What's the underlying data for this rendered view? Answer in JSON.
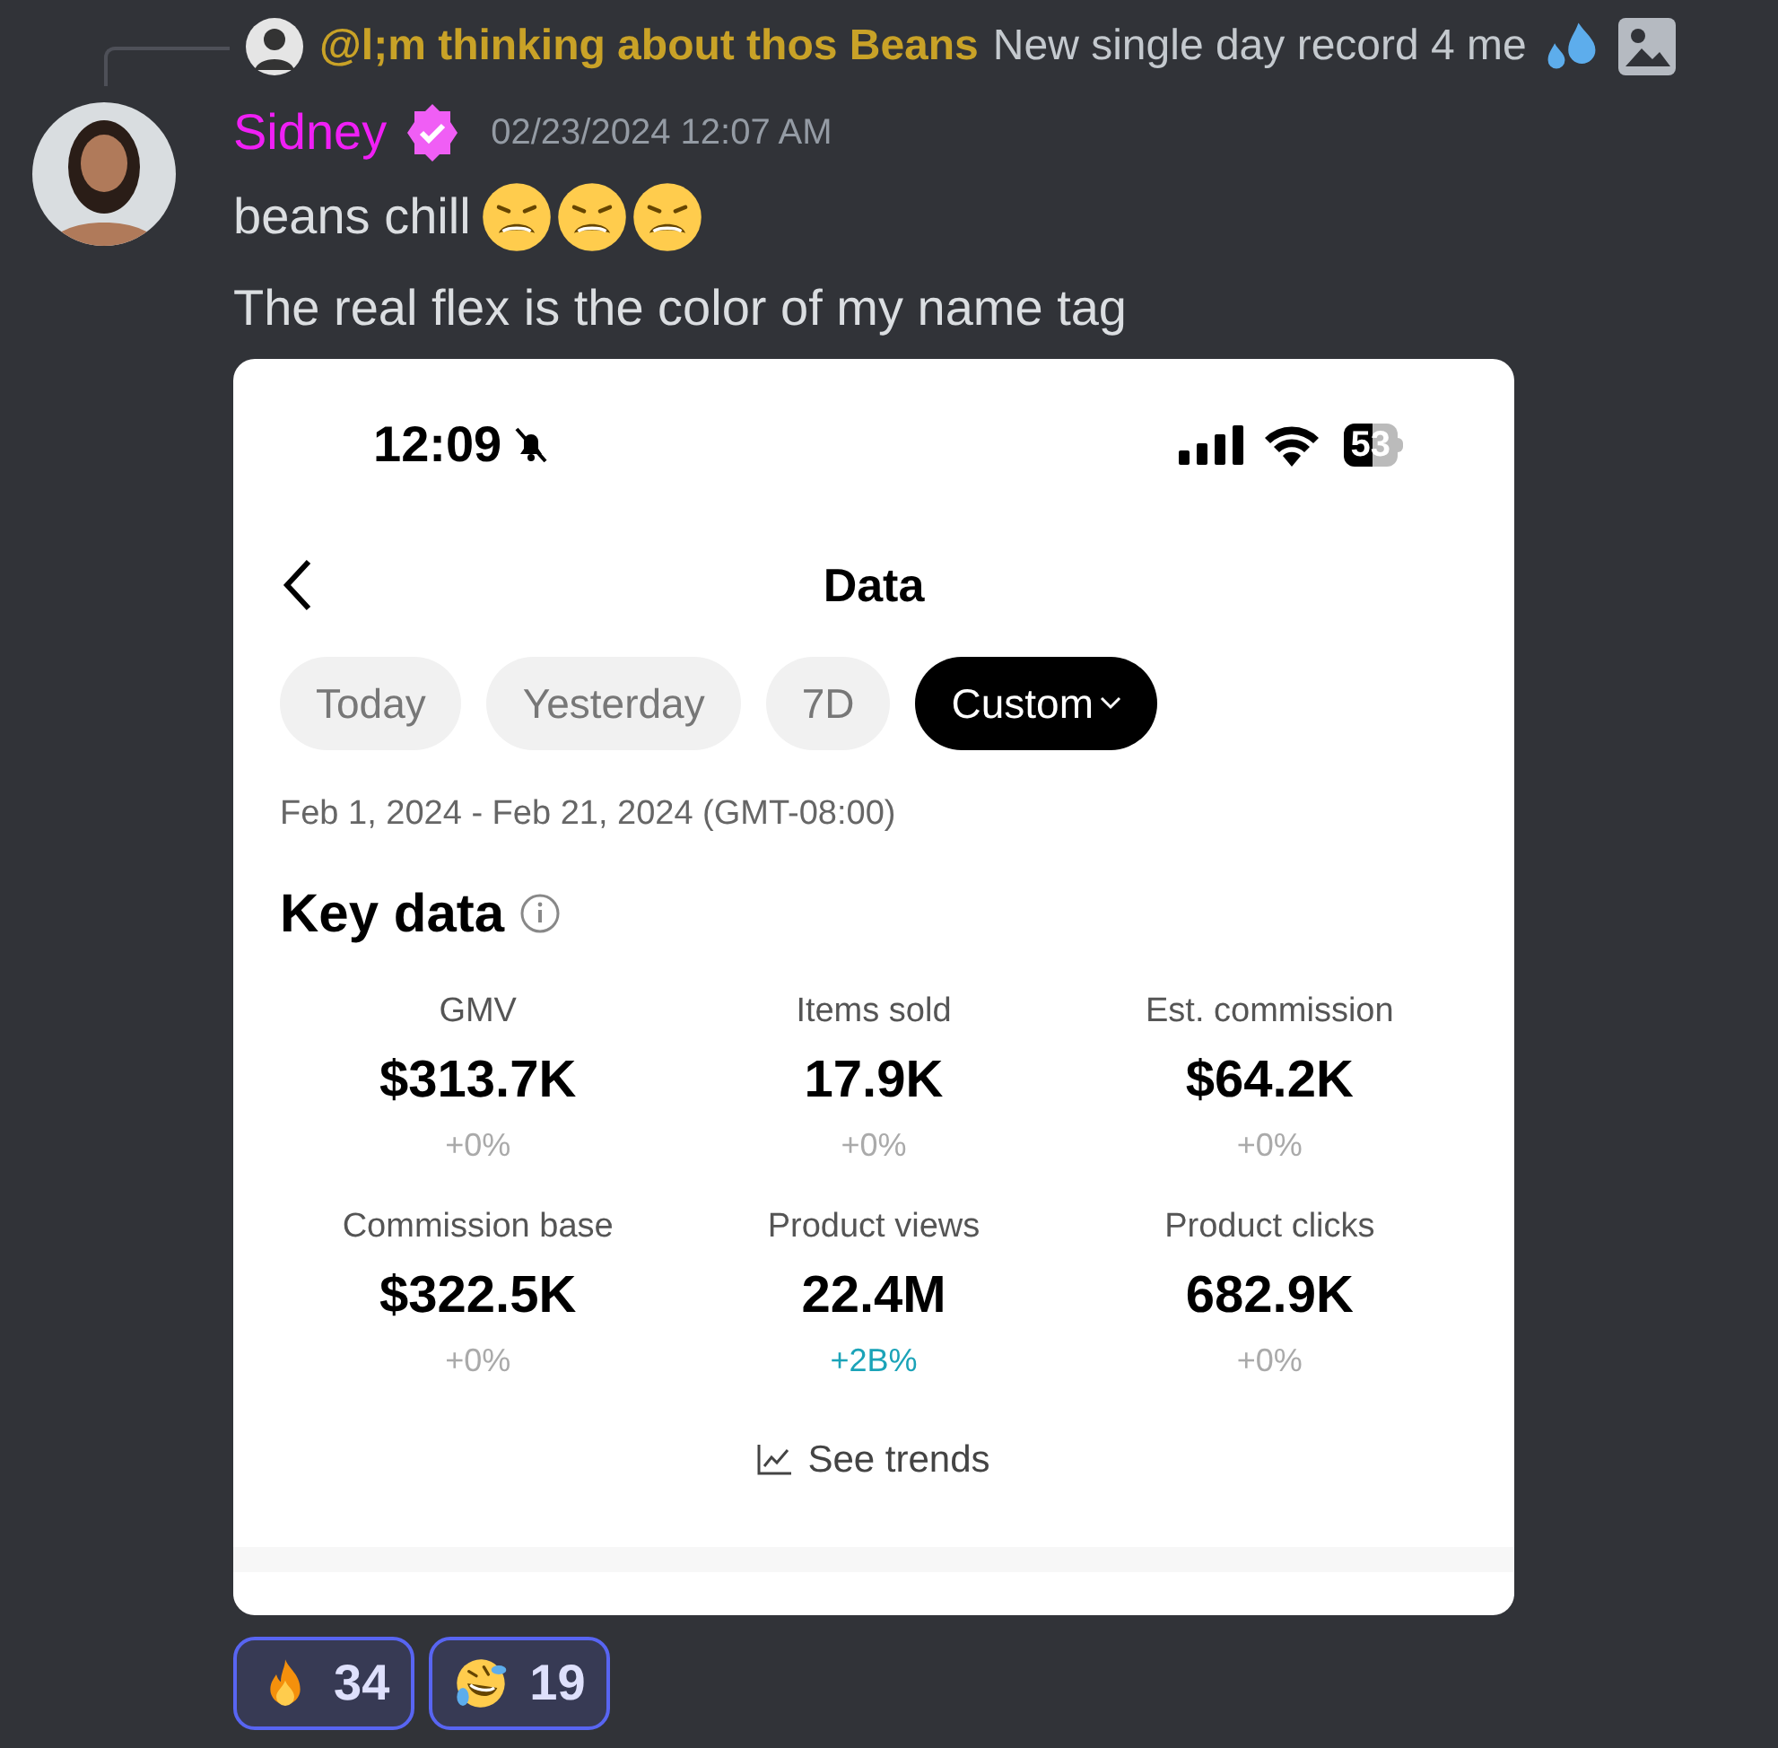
{
  "reply": {
    "author": "@l;m thinking about thos Beans",
    "text": "New single day record 4 me"
  },
  "message": {
    "author": "Sidney",
    "verified": true,
    "timestamp": "02/23/2024 12:07 AM",
    "lines": [
      "beans chill",
      "The real flex is the color of my name tag"
    ]
  },
  "screenshot": {
    "time": "12:09",
    "battery": "53",
    "title": "Data",
    "tabs": [
      {
        "label": "Today",
        "selected": false
      },
      {
        "label": "Yesterday",
        "selected": false
      },
      {
        "label": "7D",
        "selected": false
      },
      {
        "label": "Custom",
        "selected": true
      }
    ],
    "date_range": "Feb 1, 2024 - Feb 21, 2024 (GMT-08:00)",
    "section_title": "Key data",
    "metrics": [
      {
        "label": "GMV",
        "value": "$313.7K",
        "change": "+0%",
        "positive": false
      },
      {
        "label": "Items sold",
        "value": "17.9K",
        "change": "+0%",
        "positive": false
      },
      {
        "label": "Est. commission",
        "value": "$64.2K",
        "change": "+0%",
        "positive": false
      },
      {
        "label": "Commission base",
        "value": "$322.5K",
        "change": "+0%",
        "positive": false
      },
      {
        "label": "Product views",
        "value": "22.4M",
        "change": "+2B%",
        "positive": true
      },
      {
        "label": "Product clicks",
        "value": "682.9K",
        "change": "+0%",
        "positive": false
      }
    ],
    "trends_link": "See trends"
  },
  "reactions": [
    {
      "kind": "fire",
      "count": "34",
      "selected": true
    },
    {
      "kind": "laugh",
      "count": "19",
      "selected": true
    }
  ]
}
